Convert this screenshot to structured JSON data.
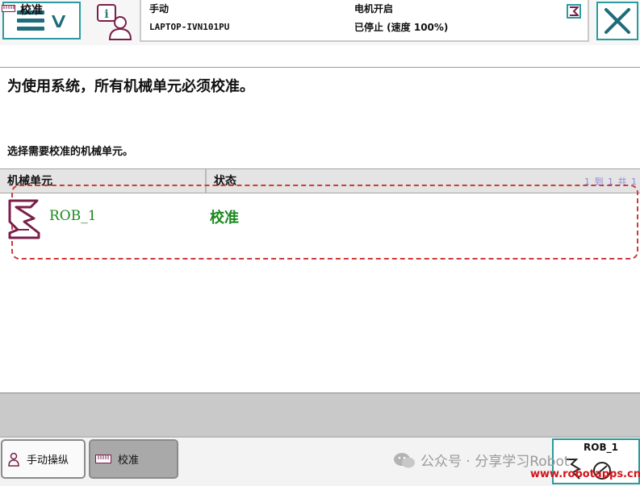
{
  "header": {
    "mode": "手动",
    "system_name": "LAPTOP-IVN101PU",
    "motors": "电机开启",
    "state": "已停止 (速度 100%)"
  },
  "title": "校准",
  "main": {
    "heading": "为使用系统，所有机械单元必须校准。",
    "subheading": "选择需要校准的机械单元。"
  },
  "table": {
    "columns": [
      "机械单元",
      "状态"
    ],
    "page_info": "1 到 1 共 1",
    "rows": [
      {
        "unit": "ROB_1",
        "status": "校准"
      }
    ]
  },
  "taskbar": {
    "items": [
      {
        "label": "手动操纵"
      },
      {
        "label": "校准"
      }
    ]
  },
  "watermark": "公众号 · 分享学习Robot",
  "quickset": {
    "unit": "ROB_1"
  },
  "site": "www.robotapps.cn",
  "colors": {
    "accent": "#2b9a9e",
    "status_green": "#198a1d",
    "robot_icon": "#7a1f4a",
    "selection": "#cc3c3c"
  }
}
